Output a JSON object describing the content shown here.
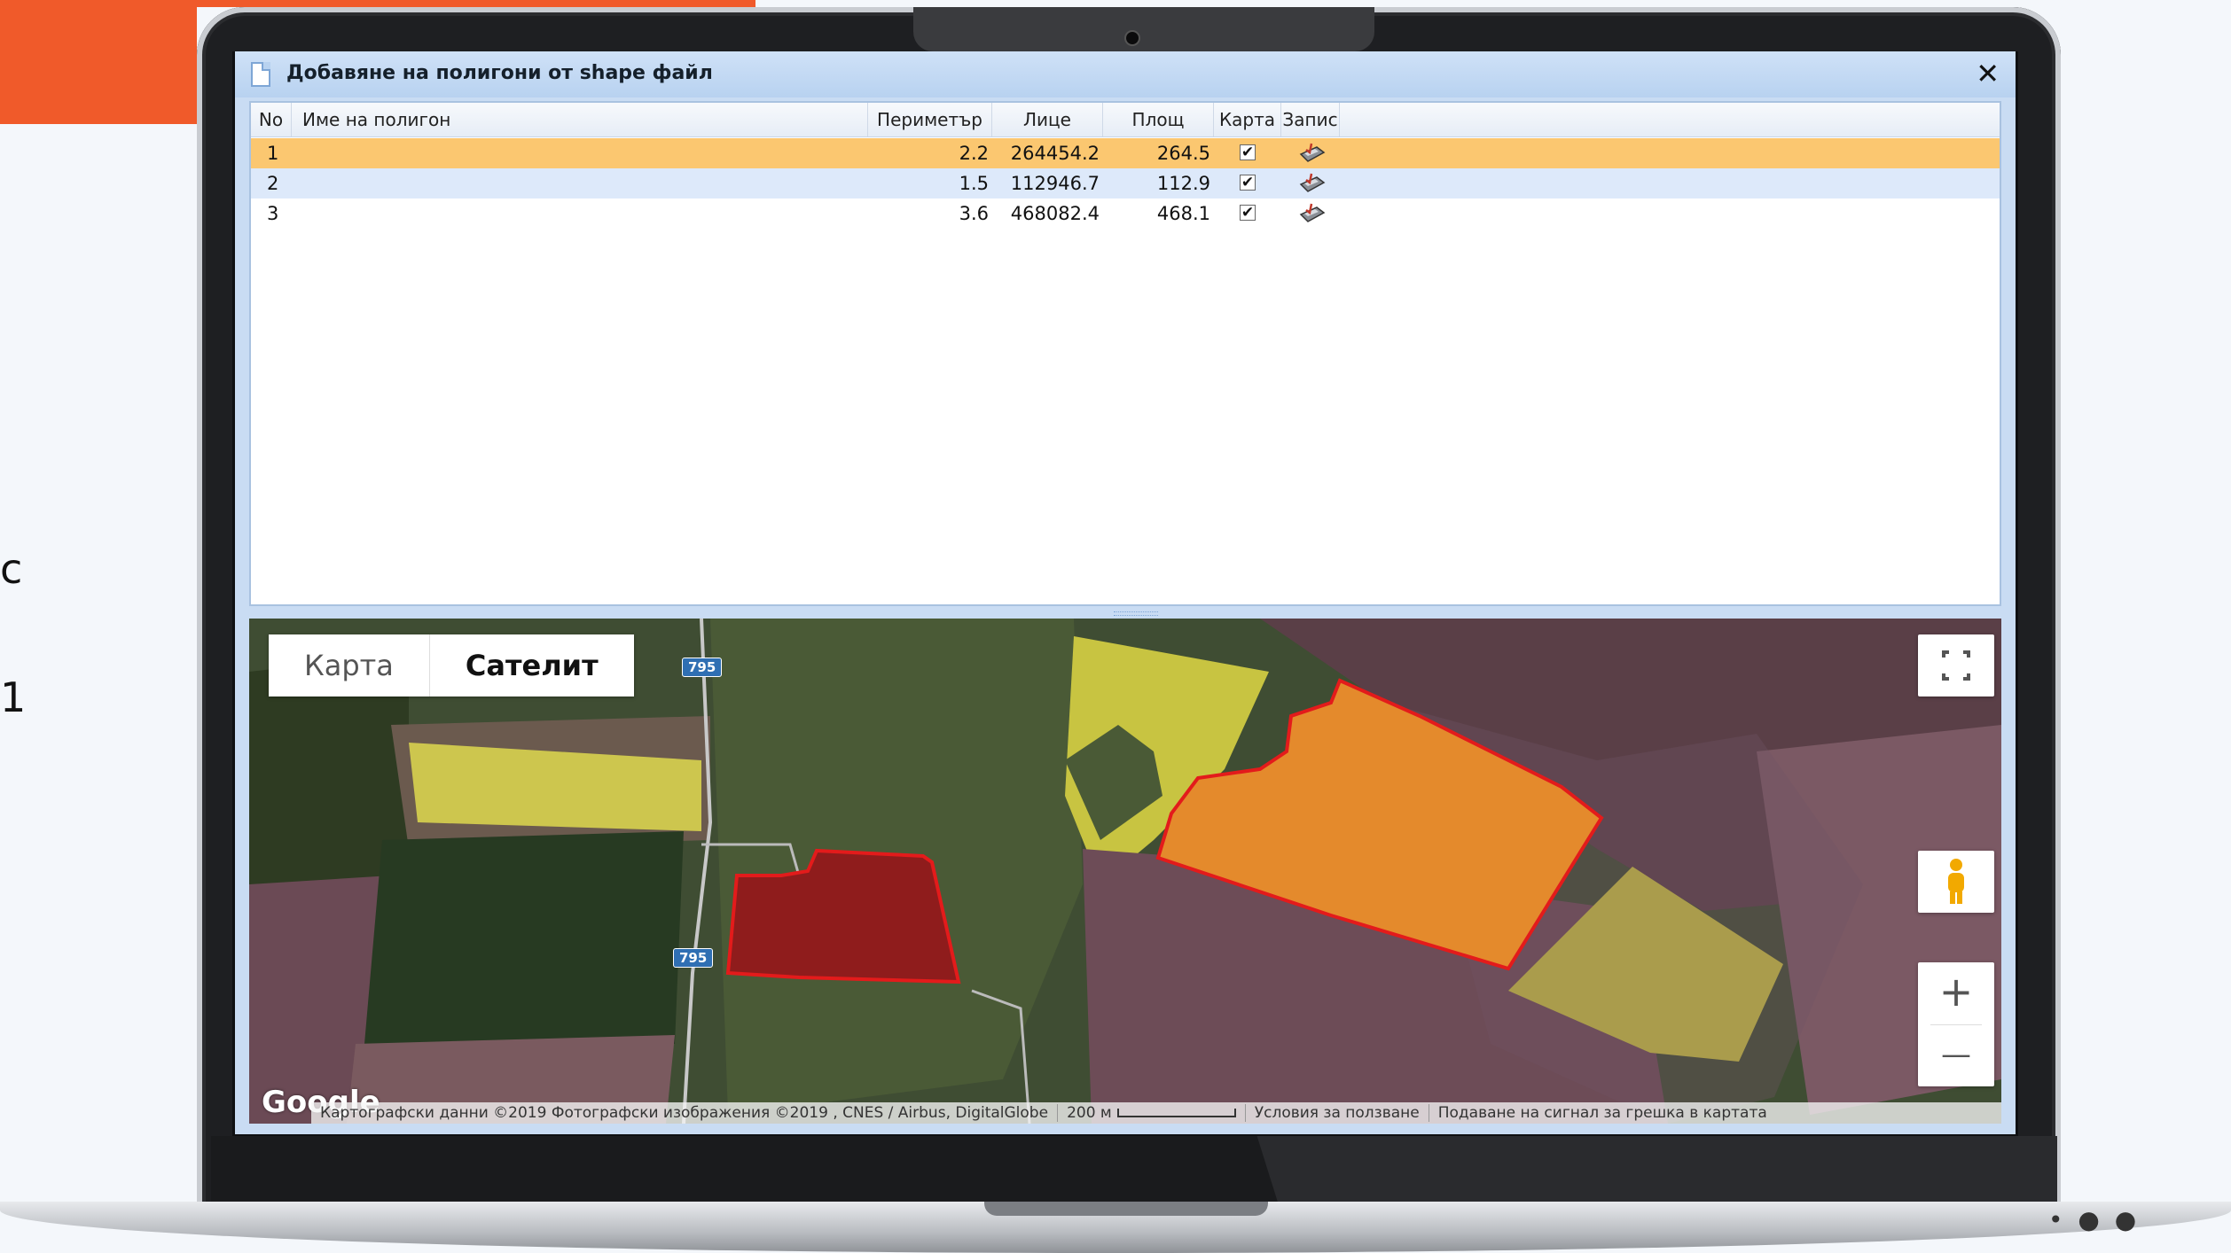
{
  "side_text": {
    "glyph_1": "c",
    "glyph_2": "1"
  },
  "dialog": {
    "title": "Добавяне на полигони от shape файл",
    "close": "✕"
  },
  "grid": {
    "headers": {
      "no": "No",
      "name": "Име на полигон",
      "perimeter": "Периметър (км)",
      "face": "Лице (кв.м.)",
      "area": "Площ (дка.)",
      "map": "Карта",
      "save": "Запис"
    },
    "rows": [
      {
        "no": "1",
        "name": "",
        "perimeter": "2.2",
        "face": "264454.2",
        "area": "264.5",
        "map_checked": "✔"
      },
      {
        "no": "2",
        "name": "",
        "perimeter": "1.5",
        "face": "112946.7",
        "area": "112.9",
        "map_checked": "✔"
      },
      {
        "no": "3",
        "name": "",
        "perimeter": "3.6",
        "face": "468082.4",
        "area": "468.1",
        "map_checked": "✔"
      }
    ]
  },
  "map": {
    "type_map": "Карта",
    "type_satellite": "Сателит",
    "road_label_1": "795",
    "road_label_2": "795",
    "logo": "Google",
    "attribution": "Картографски данни ©2019 Фотографски изображения ©2019 , CNES / Airbus, DigitalGlobe",
    "scale": "200 м",
    "terms": "Условия за ползване",
    "report": "Подаване на сигнал за грешка в картата",
    "zoom_in": "+",
    "zoom_out": "—",
    "colors": {
      "polygon_1": "#9c1f1f",
      "polygon_2": "#e8892a",
      "outline": "#e31b1b",
      "rapeseed": "#c9c443"
    }
  }
}
